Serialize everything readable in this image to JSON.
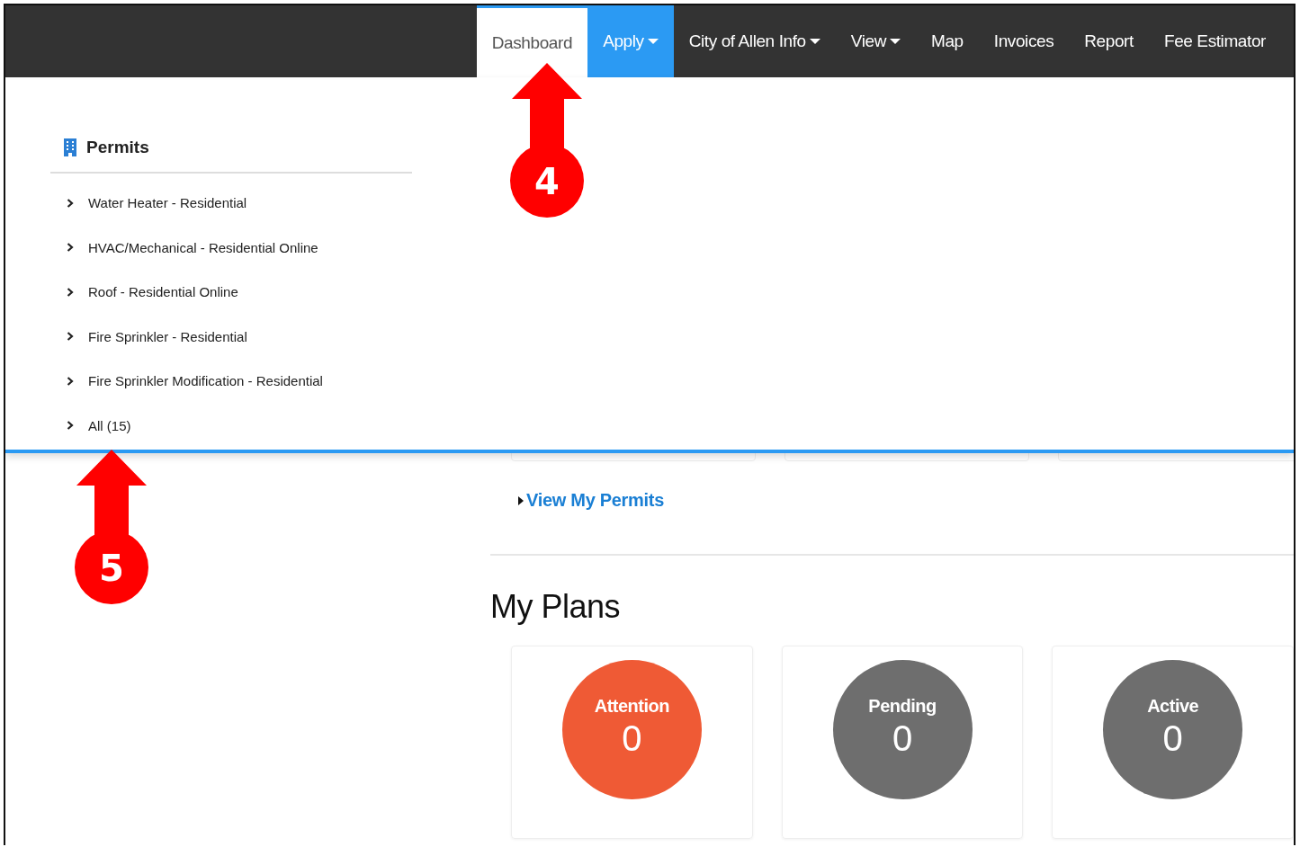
{
  "nav": {
    "tabs": [
      {
        "label": "Dashboard",
        "selected": true,
        "open": false,
        "has_caret": false
      },
      {
        "label": "Apply",
        "selected": false,
        "open": true,
        "has_caret": true
      },
      {
        "label": "City of Allen Info",
        "selected": false,
        "open": false,
        "has_caret": true
      },
      {
        "label": "View",
        "selected": false,
        "open": false,
        "has_caret": true
      },
      {
        "label": "Map",
        "selected": false,
        "open": false,
        "has_caret": false
      },
      {
        "label": "Invoices",
        "selected": false,
        "open": false,
        "has_caret": false
      },
      {
        "label": "Report",
        "selected": false,
        "open": false,
        "has_caret": false
      },
      {
        "label": "Fee Estimator",
        "selected": false,
        "open": false,
        "has_caret": false
      }
    ]
  },
  "apply_menu": {
    "heading": "Permits",
    "items": [
      "Water Heater - Residential",
      "HVAC/Mechanical - Residential Online",
      "Roof - Residential Online",
      "Fire Sprinkler - Residential",
      "Fire Sprinkler Modification - Residential",
      "All (15)"
    ]
  },
  "view_link": "View My Permits",
  "plans": {
    "title": "My Plans",
    "stats": [
      {
        "label": "Attention",
        "count": "0",
        "color": "#ef5a35"
      },
      {
        "label": "Pending",
        "count": "0",
        "color": "#6e6e6e"
      },
      {
        "label": "Active",
        "count": "0",
        "color": "#6e6e6e"
      }
    ]
  },
  "callouts": [
    {
      "number": "4"
    },
    {
      "number": "5"
    }
  ]
}
